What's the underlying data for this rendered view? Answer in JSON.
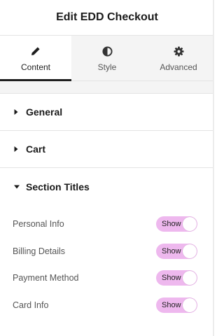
{
  "header": {
    "title": "Edit EDD Checkout"
  },
  "tabs": [
    {
      "label": "Content",
      "icon": "pencil-icon",
      "active": true
    },
    {
      "label": "Style",
      "icon": "contrast-icon",
      "active": false
    },
    {
      "label": "Advanced",
      "icon": "gear-icon",
      "active": false
    }
  ],
  "sections": [
    {
      "title": "General",
      "expanded": false
    },
    {
      "title": "Cart",
      "expanded": false
    },
    {
      "title": "Section Titles",
      "expanded": true
    }
  ],
  "section_titles": {
    "controls": [
      {
        "label": "Personal Info",
        "toggle_text": "Show",
        "on": true
      },
      {
        "label": "Billing Details",
        "toggle_text": "Show",
        "on": true
      },
      {
        "label": "Payment Method",
        "toggle_text": "Show",
        "on": true
      },
      {
        "label": "Card Info",
        "toggle_text": "Show",
        "on": true
      }
    ]
  },
  "colors": {
    "toggle_on": "#eeb8ee",
    "active_tab_indicator": "#1e1e1e",
    "inactive_tab_bg": "#f4f4f4"
  }
}
